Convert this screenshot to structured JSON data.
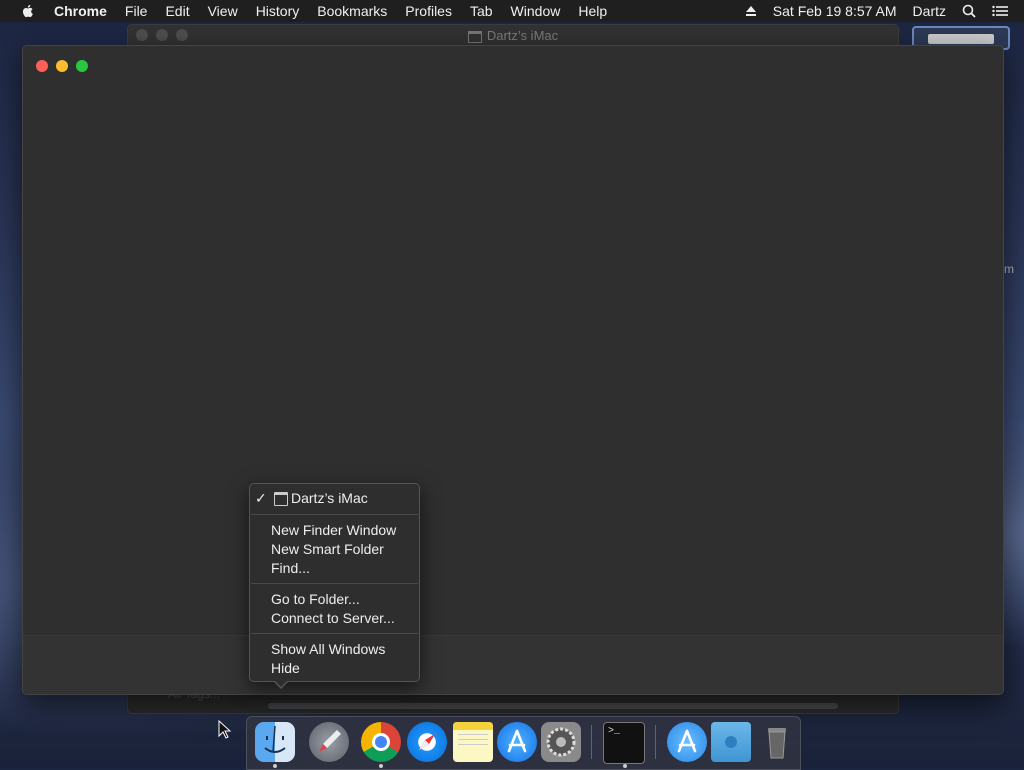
{
  "menubar": {
    "app_name": "Chrome",
    "items": [
      "File",
      "Edit",
      "View",
      "History",
      "Bookmarks",
      "Profiles",
      "Tab",
      "Window",
      "Help"
    ],
    "datetime": "Sat Feb 19  8:57 AM",
    "user": "Dartz",
    "icons": [
      "apple-icon",
      "eject-icon",
      "search-icon",
      "list-icon"
    ]
  },
  "back_window": {
    "title": "Dartz’s iMac",
    "footer_text": "All Tags..."
  },
  "side_letter": "m",
  "context_menu": {
    "header": "Dartz’s iMac",
    "check": "✓",
    "group1": [
      "New Finder Window",
      "New Smart Folder",
      "Find..."
    ],
    "group2": [
      "Go to Folder...",
      "Connect to Server..."
    ],
    "group3": [
      "Show All Windows",
      "Hide"
    ]
  },
  "dock": {
    "apps": [
      {
        "name": "Finder",
        "icon": "finder-icon",
        "running": true
      },
      {
        "name": "Launchpad",
        "icon": "launchpad-icon",
        "running": false
      },
      {
        "name": "Chrome",
        "icon": "chrome-icon",
        "running": true
      },
      {
        "name": "Safari",
        "icon": "safari-icon",
        "running": false
      },
      {
        "name": "Notes",
        "icon": "notes-icon",
        "running": false
      },
      {
        "name": "App Store",
        "icon": "appstore-icon",
        "running": false
      },
      {
        "name": "System Preferences",
        "icon": "gear-icon",
        "running": false
      },
      {
        "name": "Terminal",
        "icon": "terminal-icon",
        "running": true
      },
      {
        "name": "Applications",
        "icon": "appstore-folder-icon",
        "running": false
      },
      {
        "name": "Downloads",
        "icon": "folder-icon",
        "running": false
      },
      {
        "name": "Trash",
        "icon": "trash-icon",
        "running": false
      }
    ],
    "terminal_prompt": ">_"
  }
}
